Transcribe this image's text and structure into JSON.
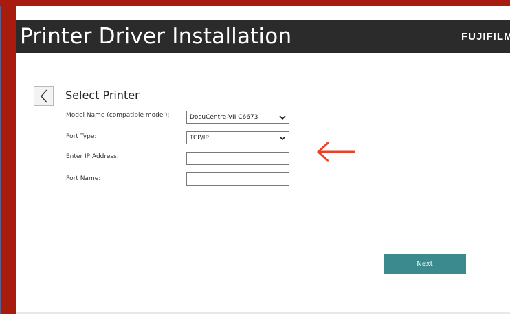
{
  "window": {
    "title": "Printer Driver Installation",
    "brand": "FUJIFILM"
  },
  "page": {
    "heading": "Select Printer",
    "back_icon": "chevron-left-icon"
  },
  "form": {
    "model_name": {
      "label": "Model Name (compatible model):",
      "value": "DocuCentre-VII C6673"
    },
    "port_type": {
      "label": "Port Type:",
      "value": "TCP/IP"
    },
    "ip_address": {
      "label": "Enter IP Address:",
      "value": ""
    },
    "port_name": {
      "label": "Port Name:",
      "value": ""
    }
  },
  "actions": {
    "next_label": "Next"
  },
  "annotation": {
    "icon": "left-arrow-icon",
    "color": "#e8432a"
  },
  "colors": {
    "frame": "#a81c0f",
    "title_bar": "#2b2b2b",
    "next_button": "#3b8a8e"
  }
}
